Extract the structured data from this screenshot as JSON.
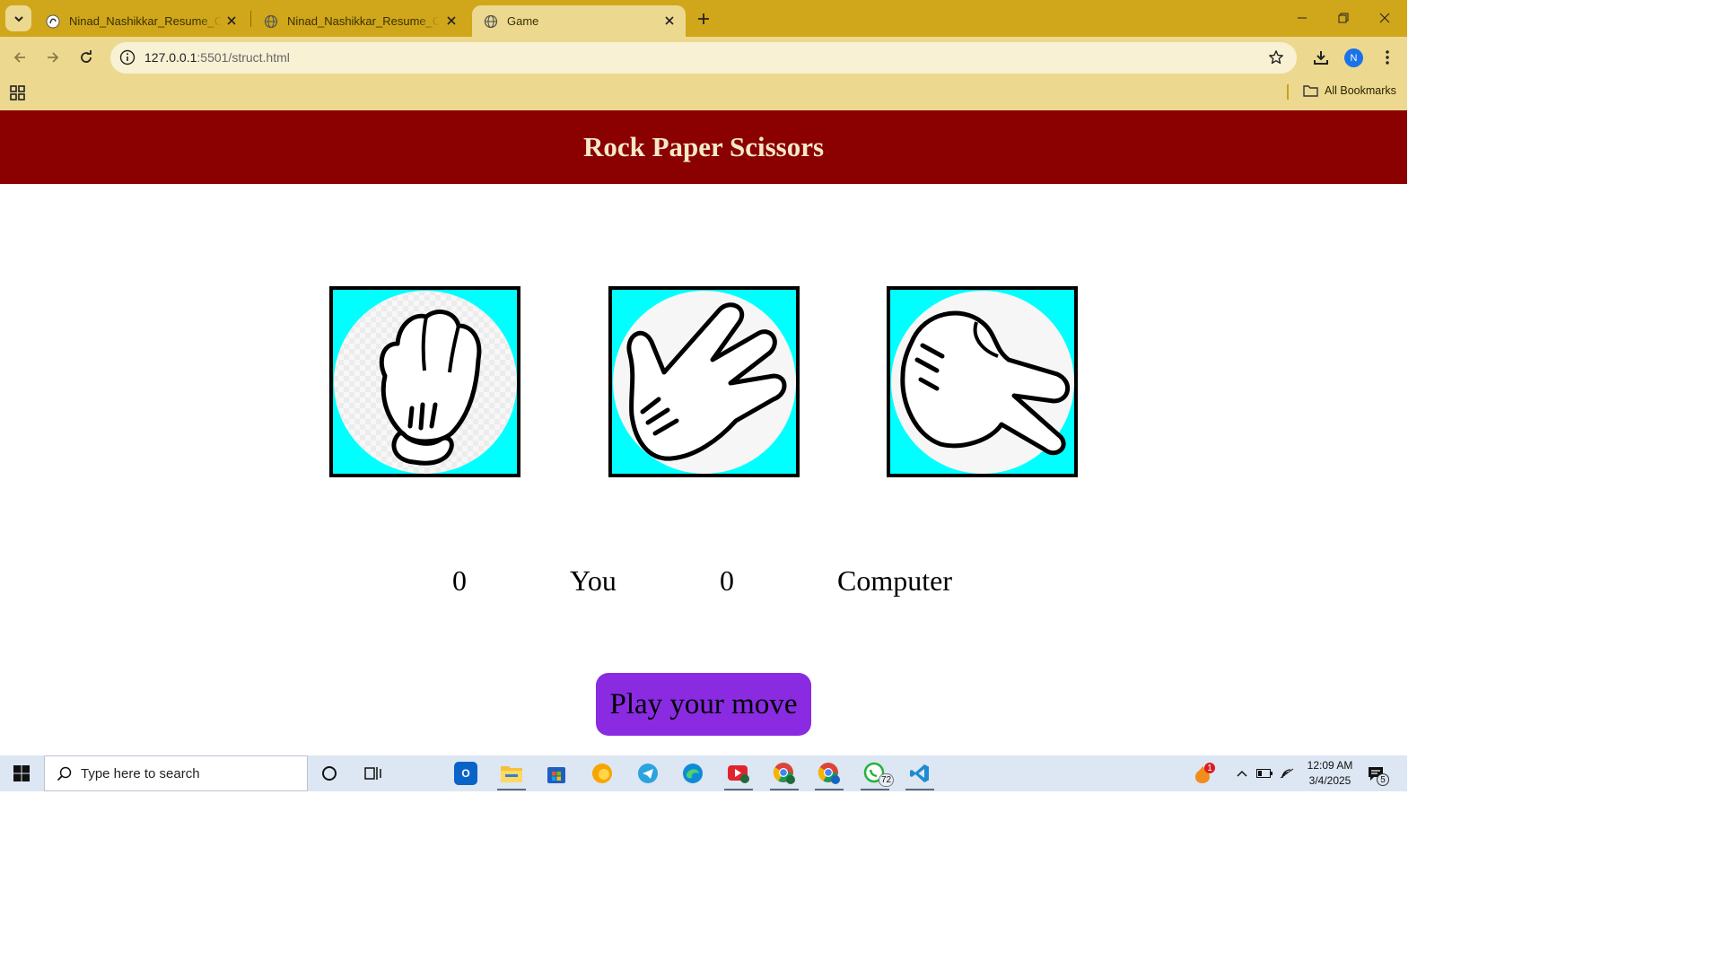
{
  "browser": {
    "tabs": [
      {
        "title": "Ninad_Nashikkar_Resume_Cogn",
        "active": false
      },
      {
        "title": "Ninad_Nashikkar_Resume_Cogn",
        "active": false
      },
      {
        "title": "Game",
        "active": true
      }
    ],
    "url_host": "127.0.0.1",
    "url_rest": ":5501/struct.html",
    "profile_initial": "N",
    "bookmarks_label": "All Bookmarks",
    "accent_color": "#d0a71a"
  },
  "game": {
    "title": "Rock Paper Scissors",
    "header_color": "#8b0000",
    "choices": [
      {
        "name": "rock",
        "icon": "rock-hand-icon"
      },
      {
        "name": "paper",
        "icon": "paper-hand-icon"
      },
      {
        "name": "scissors",
        "icon": "scissors-hand-icon"
      }
    ],
    "choice_bg_color": "#00ffff",
    "scores": {
      "user_score": "0",
      "user_label": "You",
      "computer_score": "0",
      "computer_label": "Computer"
    },
    "message": "Play your move",
    "message_bg_color": "#8a2be2"
  },
  "taskbar": {
    "search_placeholder": "Type here to search",
    "apps": [
      "cortana-icon",
      "task-view-icon",
      "outlook-icon",
      "file-explorer-icon",
      "microsoft-store-icon",
      "edge-canary-icon",
      "telegram-icon",
      "edge-icon",
      "media-app-icon",
      "chrome-icon",
      "chrome-icon",
      "whatsapp-icon",
      "vscode-icon"
    ],
    "whatsapp_badge": "72",
    "tray_badge": "1",
    "time": "12:09 AM",
    "date": "3/4/2025",
    "notification_count": "5"
  }
}
